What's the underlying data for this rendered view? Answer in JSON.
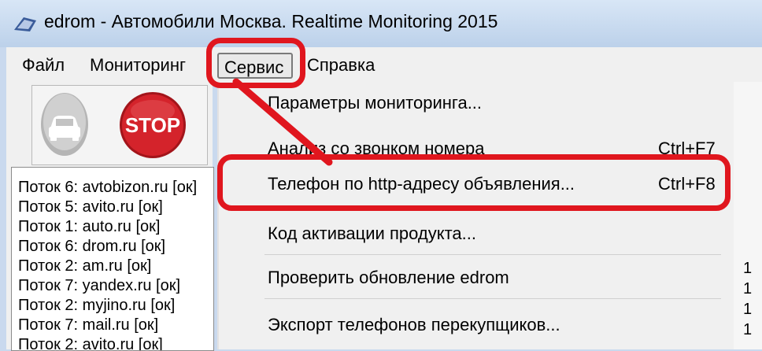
{
  "window": {
    "title": "edrom - Автомобили Москва. Realtime Monitoring 2015"
  },
  "menu": {
    "file": "Файл",
    "monitoring": "Мониторинг",
    "service": "Сервис",
    "help": "Справка"
  },
  "toolbar": {
    "stop_label": "STOP"
  },
  "log": {
    "lines": [
      "Поток 6: avtobizon.ru [ок]",
      "Поток 5: avito.ru [ок]",
      "Поток 1: auto.ru [ок]",
      "Поток 6: drom.ru [ок]",
      "Поток 2: am.ru [ок]",
      "Поток 7: yandex.ru [ок]",
      "Поток 2: myjino.ru [ок]",
      "Поток 7: mail.ru [ок]",
      "Поток 2: avito.ru [ок]"
    ]
  },
  "dropdown": {
    "items": [
      {
        "label": "Параметры мониторинга...",
        "shortcut": ""
      },
      {
        "label": "Анализ со звонком номера",
        "shortcut": "Ctrl+F7"
      },
      {
        "label": "Телефон по http-адресу объявления...",
        "shortcut": "Ctrl+F8"
      },
      {
        "label": "Код активации продукта...",
        "shortcut": ""
      },
      {
        "label": "Проверить обновление edrom",
        "shortcut": ""
      },
      {
        "label": "Экспорт телефонов перекупщиков...",
        "shortcut": ""
      }
    ]
  },
  "right_partial": [
    "1",
    "1",
    "1",
    "1"
  ],
  "colors": {
    "highlight": "#e0161e",
    "stop": "#d4232b",
    "menu_bg": "#f0f0f0",
    "title_bg": "#c9d9ee"
  }
}
